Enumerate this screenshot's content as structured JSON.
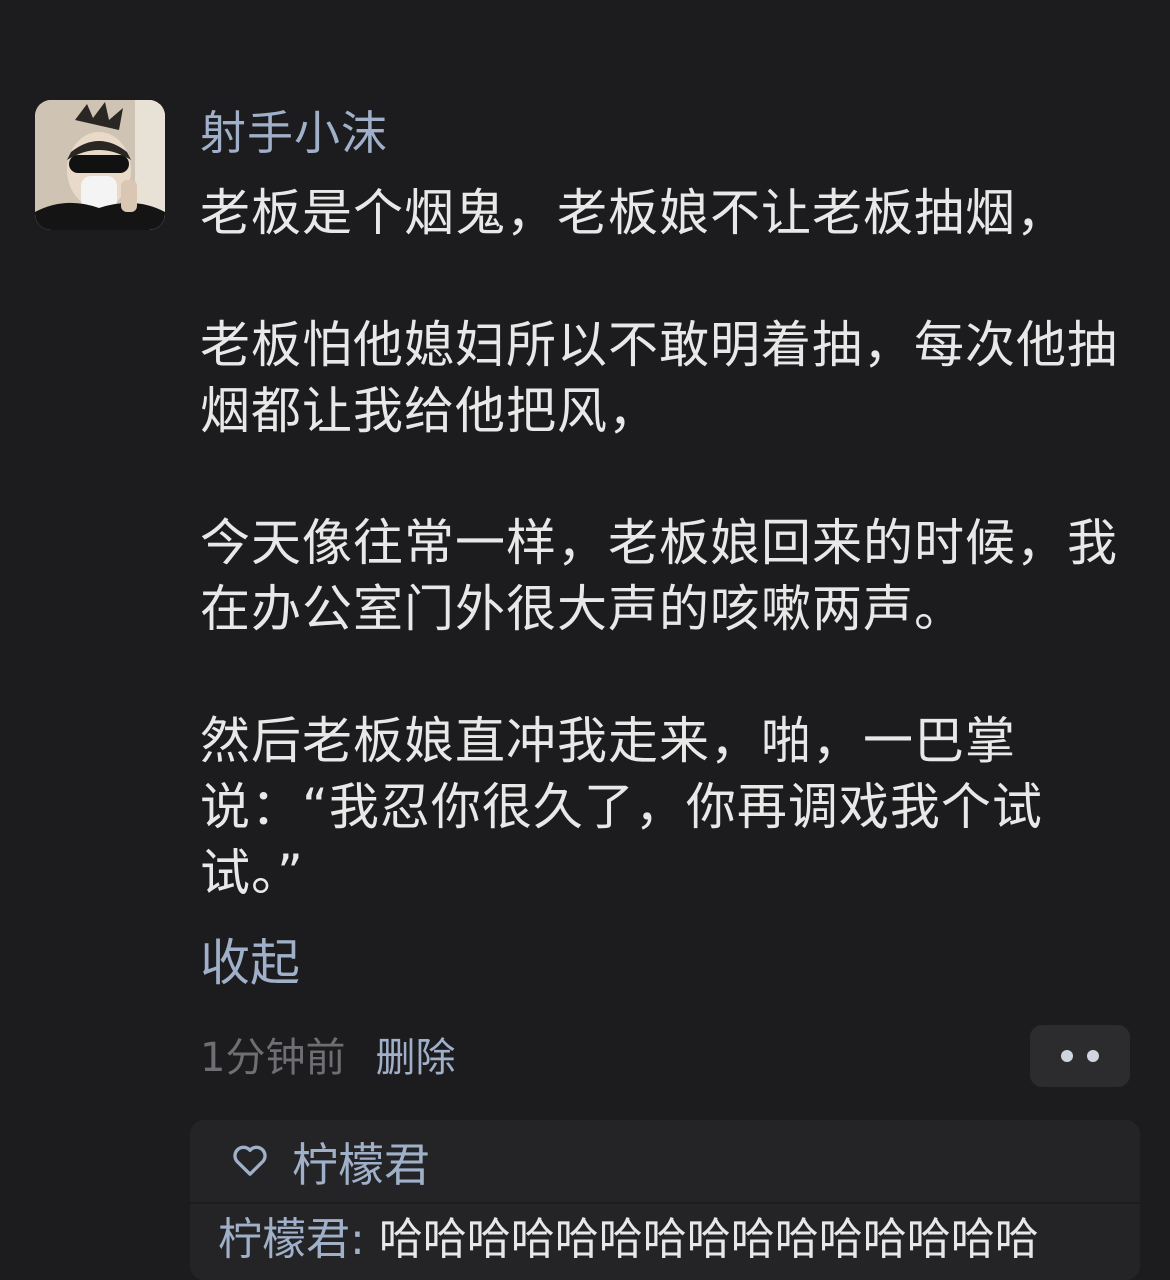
{
  "post": {
    "author": "射手小沫",
    "paragraphs": [
      "老板是个烟鬼，老板娘不让老板抽烟，",
      "老板怕他媳妇所以不敢明着抽，每次他抽烟都让我给他把风，",
      "今天像往常一样，老板娘回来的时候，我在办公室门外很大声的咳嗽两声。",
      "然后老板娘直冲我走来，啪，一巴掌说：“我忍你很久了，你再调戏我个试试。”"
    ],
    "collapse_label": "收起",
    "time": "1分钟前",
    "delete_label": "删除",
    "more_icon": "more-dots-icon"
  },
  "likes": {
    "icon": "heart-icon",
    "names": "柠檬君"
  },
  "reply": {
    "author": "柠檬君",
    "separator": ": ",
    "text": "哈哈哈哈哈哈哈哈哈哈哈哈哈哈哈"
  }
}
